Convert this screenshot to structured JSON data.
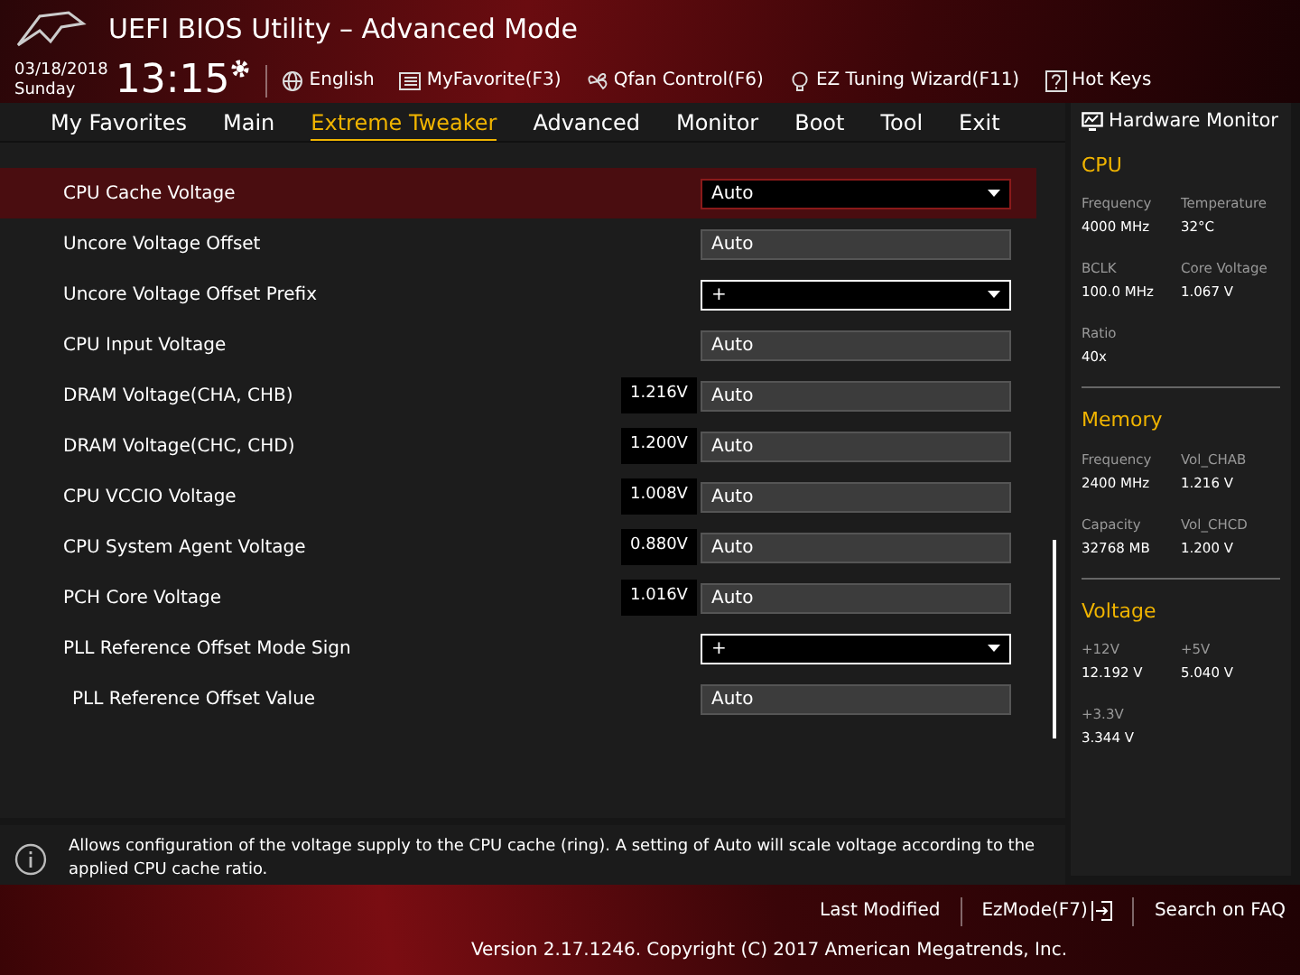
{
  "header": {
    "title": "UEFI BIOS Utility – Advanced Mode",
    "date": "03/18/2018",
    "day": "Sunday",
    "time": "13:15",
    "tools": [
      {
        "kind": "globe",
        "label": "English"
      },
      {
        "kind": "favorite",
        "label": "MyFavorite(F3)"
      },
      {
        "kind": "fan",
        "label": "Qfan Control(F6)"
      },
      {
        "kind": "bulb",
        "label": "EZ Tuning Wizard(F11)"
      },
      {
        "kind": "help",
        "label": "Hot Keys"
      }
    ]
  },
  "tabs": [
    {
      "label": "My Favorites",
      "selected": false
    },
    {
      "label": "Main",
      "selected": false
    },
    {
      "label": "Extreme Tweaker",
      "selected": true
    },
    {
      "label": "Advanced",
      "selected": false
    },
    {
      "label": "Monitor",
      "selected": false
    },
    {
      "label": "Boot",
      "selected": false
    },
    {
      "label": "Tool",
      "selected": false
    },
    {
      "label": "Exit",
      "selected": false
    }
  ],
  "settings": [
    {
      "label": "CPU Cache Voltage",
      "kind": "dropdown",
      "value": "Auto",
      "selected": true
    },
    {
      "label": "Uncore Voltage Offset",
      "kind": "text",
      "value": "Auto",
      "selected": false
    },
    {
      "label": "Uncore Voltage Offset Prefix",
      "kind": "dropdown",
      "value": "+",
      "selected": false
    },
    {
      "label": "CPU Input Voltage",
      "kind": "text",
      "value": "Auto",
      "selected": false
    },
    {
      "label": "DRAM Voltage(CHA, CHB)",
      "kind": "text",
      "reading": "1.216V",
      "value": "Auto",
      "selected": false
    },
    {
      "label": "DRAM Voltage(CHC, CHD)",
      "kind": "text",
      "reading": "1.200V",
      "value": "Auto",
      "selected": false
    },
    {
      "label": "CPU VCCIO Voltage",
      "kind": "text",
      "reading": "1.008V",
      "value": "Auto",
      "selected": false
    },
    {
      "label": "CPU System Agent Voltage",
      "kind": "text",
      "reading": "0.880V",
      "value": "Auto",
      "selected": false
    },
    {
      "label": "PCH Core Voltage",
      "kind": "text",
      "reading": "1.016V",
      "value": "Auto",
      "selected": false
    },
    {
      "label": "PLL Reference Offset Mode Sign",
      "kind": "dropdown",
      "value": "+",
      "selected": false
    },
    {
      "label": "PLL Reference Offset Value",
      "kind": "text",
      "value": "Auto",
      "selected": false,
      "indented": true
    }
  ],
  "help_text": "Allows configuration of the voltage supply to the CPU cache (ring). A setting of Auto will scale voltage according to the applied CPU cache ratio.",
  "hardware_monitor": {
    "title": "Hardware Monitor",
    "sections": [
      {
        "title": "CPU",
        "items": [
          {
            "label": "Frequency",
            "value": "4000 MHz"
          },
          {
            "label": "Temperature",
            "value": "32°C"
          },
          {
            "label": "BCLK",
            "value": "100.0 MHz"
          },
          {
            "label": "Core Voltage",
            "value": "1.067 V"
          },
          {
            "label": "Ratio",
            "value": "40x"
          }
        ]
      },
      {
        "title": "Memory",
        "items": [
          {
            "label": "Frequency",
            "value": "2400 MHz"
          },
          {
            "label": "Vol_CHAB",
            "value": "1.216 V"
          },
          {
            "label": "Capacity",
            "value": "32768 MB"
          },
          {
            "label": "Vol_CHCD",
            "value": "1.200 V"
          }
        ]
      },
      {
        "title": "Voltage",
        "items": [
          {
            "label": "+12V",
            "value": "12.192 V"
          },
          {
            "label": "+5V",
            "value": "5.040 V"
          },
          {
            "label": "+3.3V",
            "value": "3.344 V"
          }
        ]
      }
    ]
  },
  "footer": {
    "links": [
      {
        "kind": "plain",
        "label": "Last Modified"
      },
      {
        "kind": "exit",
        "label": "EzMode(F7)"
      },
      {
        "kind": "plain",
        "label": "Search on FAQ"
      }
    ],
    "copyright": "Version 2.17.1246. Copyright (C) 2017 American Megatrends, Inc."
  }
}
